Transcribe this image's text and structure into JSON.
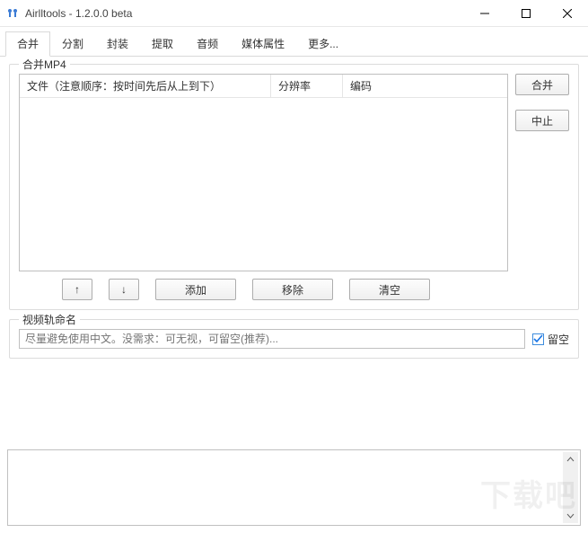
{
  "window": {
    "title": "Airlltools  -  1.2.0.0 beta"
  },
  "tabs": {
    "items": [
      {
        "label": "合并",
        "active": true
      },
      {
        "label": "分割"
      },
      {
        "label": "封装"
      },
      {
        "label": "提取"
      },
      {
        "label": "音频"
      },
      {
        "label": "媒体属性"
      },
      {
        "label": "更多..."
      }
    ]
  },
  "merge": {
    "group_label": "合并MP4",
    "columns": {
      "file": "文件（注意顺序：按时间先后从上到下）",
      "resolution": "分辨率",
      "codec": "编码"
    },
    "side": {
      "start": "合并",
      "stop": "中止"
    },
    "toolbar": {
      "up": "↑",
      "down": "↓",
      "add": "添加",
      "remove": "移除",
      "clear": "清空"
    }
  },
  "track": {
    "group_label": "视频轨命名",
    "placeholder": "尽量避免使用中文。没需求：可无视，可留空(推荐)...",
    "leave_blank": "留空",
    "checked": true
  },
  "watermark": "下载吧"
}
